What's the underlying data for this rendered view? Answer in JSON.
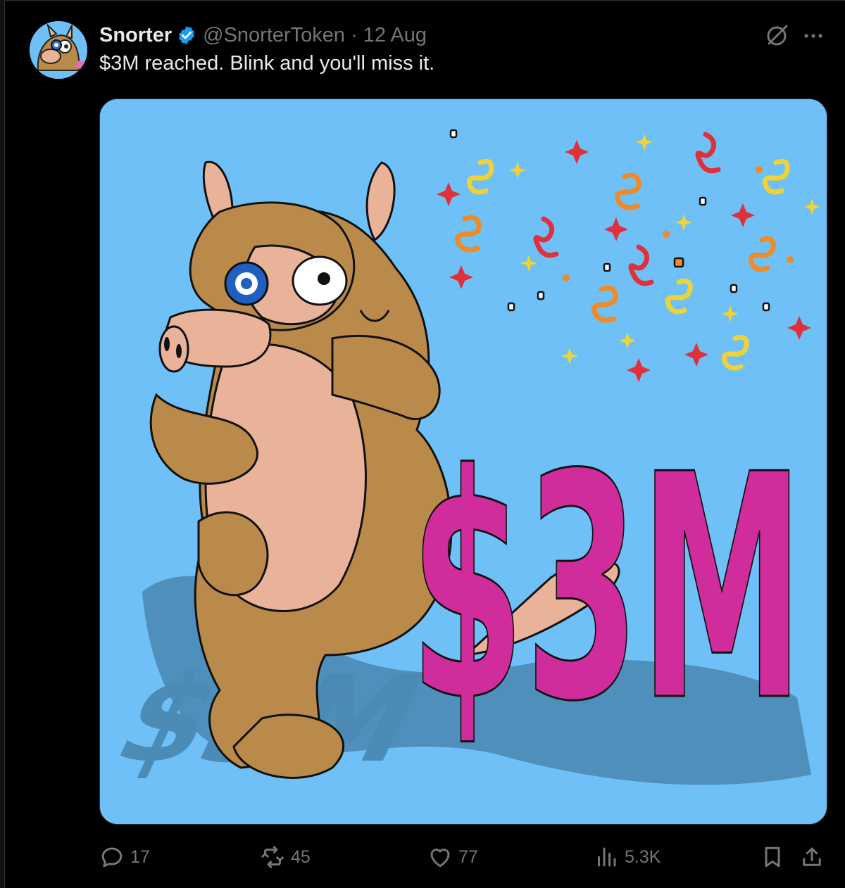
{
  "tweet": {
    "display_name": "Snorter",
    "handle": "@SnorterToken",
    "separator": "·",
    "date": "12 Aug",
    "text": "$3M reached. Blink and you'll miss it.",
    "verified": true,
    "media": {
      "big_text": "$3M",
      "background": "#6ec0f7",
      "text_color": "#d02c9c"
    }
  },
  "actions": {
    "replies": "17",
    "reposts": "45",
    "likes": "77",
    "views": "5.3K"
  },
  "icons": [
    "grok-icon",
    "more-icon",
    "reply-icon",
    "repost-icon",
    "like-icon",
    "views-icon",
    "bookmark-icon",
    "share-icon"
  ],
  "colors": {
    "background": "#000000",
    "text": "#e7e9ea",
    "muted": "#71767b",
    "verified": "#1d9bf0"
  }
}
